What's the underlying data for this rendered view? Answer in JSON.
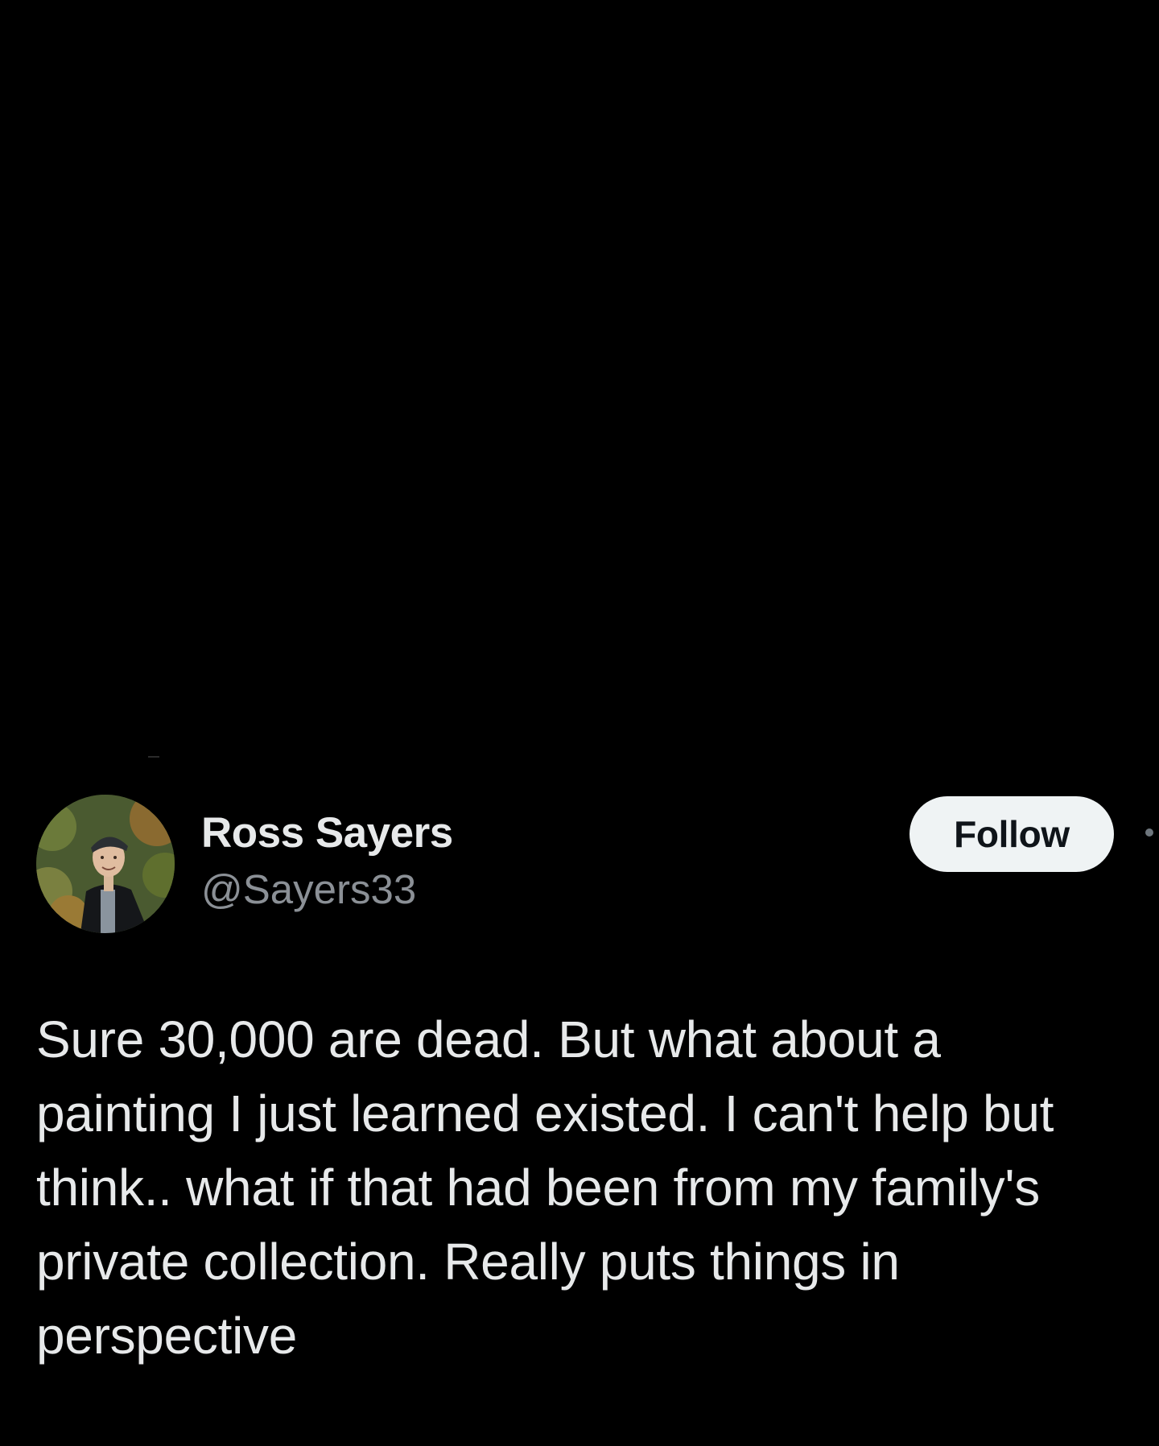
{
  "tweet": {
    "author": {
      "display_name": "Ross Sayers",
      "handle": "@Sayers33",
      "avatar_icon": "profile-photo"
    },
    "follow_label": "Follow",
    "text": "Sure 30,000 are dead. But what about a\npainting I just learned existed. I can't help but\nthink.. what if that had been from my family's\nprivate collection. Really puts things in\nperspective"
  },
  "colors": {
    "background": "#000000",
    "primary_text": "#e7e9ea",
    "secondary_text": "#8b9096",
    "follow_button_bg": "#eff3f4",
    "follow_button_text": "#0f1419"
  }
}
